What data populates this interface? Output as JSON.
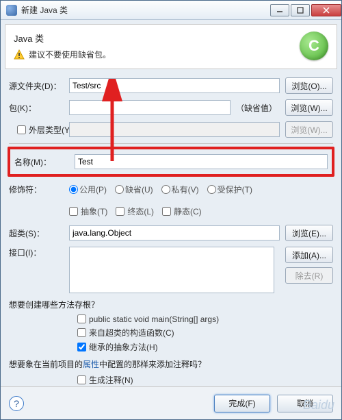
{
  "title": "新建 Java 类",
  "header": {
    "title": "Java 类",
    "warning": "建议不要使用缺省包。",
    "logo_letter": "C"
  },
  "fields": {
    "source_folder": {
      "label": "源文件夹(D)：",
      "value": "Test/src",
      "browse": "浏览(O)..."
    },
    "package": {
      "label": "包(K)：",
      "value": "",
      "default_text": "（缺省值）",
      "browse": "浏览(W)..."
    },
    "enclosing": {
      "label": "外层类型(Y)：",
      "value": "",
      "browse": "浏览(W)..."
    },
    "name": {
      "label": "名称(M)：",
      "value": "Test"
    },
    "modifiers": {
      "label": "修饰符：",
      "public": "公用(P)",
      "default": "缺省(U)",
      "private": "私有(V)",
      "protected": "受保护(T)",
      "abstract": "抽象(T)",
      "final": "终态(L)",
      "static": "静态(C)"
    },
    "superclass": {
      "label": "超类(S)：",
      "value": "java.lang.Object",
      "browse": "浏览(E)..."
    },
    "interfaces": {
      "label": "接口(I)：",
      "add": "添加(A)...",
      "remove": "除去(R)"
    }
  },
  "stubs": {
    "question": "想要创建哪些方法存根？",
    "main": "public static void main(String[] args)",
    "constructors": "来自超类的构造函数(C)",
    "inherited": "继承的抽象方法(H)"
  },
  "comments": {
    "question_pre": "想要象在当前项目的",
    "question_link": "属性",
    "question_post": "中配置的那样来添加注释吗？",
    "generate": "生成注释(N)"
  },
  "footer": {
    "finish": "完成(F)",
    "cancel": "取消"
  },
  "watermark": "Baidu"
}
